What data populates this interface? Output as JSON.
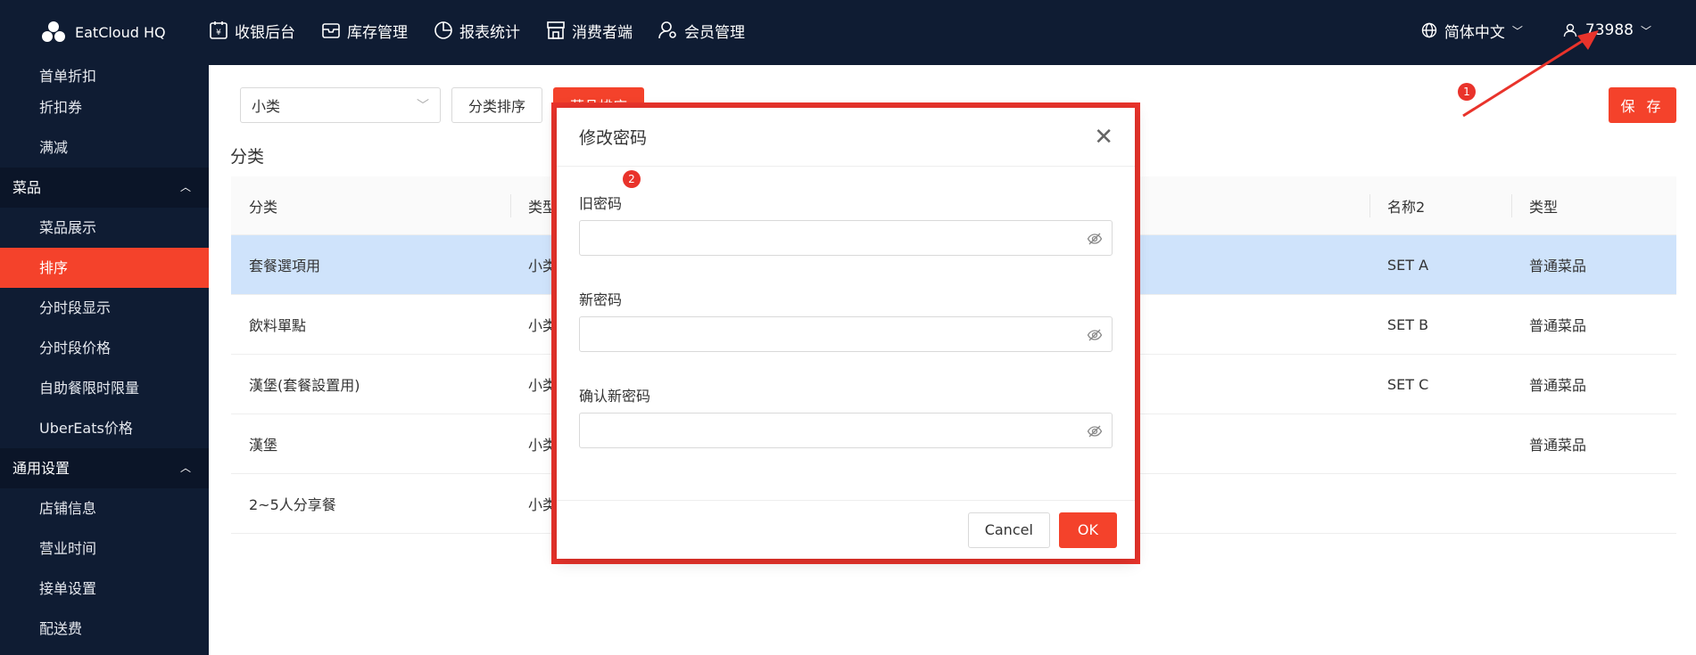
{
  "header": {
    "brand": "EatCloud HQ",
    "nav": [
      {
        "label": "收银后台",
        "icon": "cashier-icon"
      },
      {
        "label": "库存管理",
        "icon": "inventory-icon"
      },
      {
        "label": "报表统计",
        "icon": "pie-chart-icon"
      },
      {
        "label": "消费者端",
        "icon": "store-icon"
      },
      {
        "label": "会员管理",
        "icon": "member-icon"
      }
    ],
    "language": "简体中文",
    "user": "73988"
  },
  "sidebar": {
    "items_top": [
      "首单折扣",
      "折扣券",
      "满减"
    ],
    "group_dishes": "菜品",
    "dish_items": [
      "菜品展示",
      "排序",
      "分时段显示",
      "分时段价格",
      "自助餐限时限量",
      "UberEats价格"
    ],
    "group_general": "通用设置",
    "general_items": [
      "店铺信息",
      "营业时间",
      "接单设置",
      "配送费"
    ]
  },
  "toolbar": {
    "select_value": "小类",
    "category_sort": "分类排序",
    "dish_sort": "菜品排序",
    "save": "保 存"
  },
  "section_title": "分类",
  "table": {
    "headers": [
      "分类",
      "类型",
      "名称2",
      "类型"
    ],
    "rows": [
      {
        "category": "套餐選項用",
        "type": "小类",
        "name2": "SET A",
        "dish_type": "普通菜品"
      },
      {
        "category": "飲料單點",
        "type": "小类",
        "name2": "SET B",
        "dish_type": "普通菜品"
      },
      {
        "category": "漢堡(套餐設置用)",
        "type": "小类",
        "name2": "SET C",
        "dish_type": "普通菜品"
      },
      {
        "category": "漢堡",
        "type": "小类",
        "name2": "",
        "dish_type": "普通菜品"
      },
      {
        "category": "2~5人分享餐",
        "type": "小类",
        "name2": "",
        "dish_type": ""
      }
    ]
  },
  "annotations": {
    "badge1": "1",
    "badge2": "2",
    "color": "#e9332b"
  },
  "modal": {
    "title": "修改密码",
    "old_password": "旧密码",
    "new_password": "新密码",
    "confirm_password": "确认新密码",
    "cancel": "Cancel",
    "ok": "OK"
  },
  "colors": {
    "header_bg": "#0f1c33",
    "accent": "#f4422b",
    "selected_row": "#cfe3fb"
  }
}
